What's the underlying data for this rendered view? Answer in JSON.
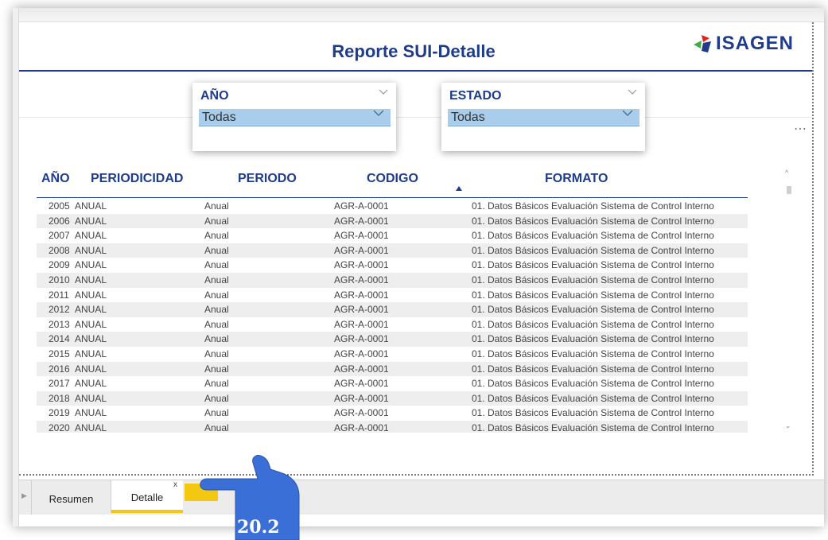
{
  "header": {
    "title": "Reporte SUI-Detalle",
    "logo_text": "ISAGEN"
  },
  "slicers": [
    {
      "label": "AÑO",
      "value": "Todas"
    },
    {
      "label": "ESTADO",
      "value": "Todas"
    }
  ],
  "table": {
    "columns": [
      "AÑO",
      "PERIODICIDAD",
      "PERIODO",
      "CODIGO",
      "FORMATO"
    ],
    "sorted_column": "FORMATO",
    "rows": [
      [
        "2005",
        "ANUAL",
        "Anual",
        "AGR-A-0001",
        "01. Datos Básicos Evaluación Sistema de Control Interno"
      ],
      [
        "2006",
        "ANUAL",
        "Anual",
        "AGR-A-0001",
        "01. Datos Básicos Evaluación Sistema de Control Interno"
      ],
      [
        "2007",
        "ANUAL",
        "Anual",
        "AGR-A-0001",
        "01. Datos Básicos Evaluación Sistema de Control Interno"
      ],
      [
        "2008",
        "ANUAL",
        "Anual",
        "AGR-A-0001",
        "01. Datos Básicos Evaluación Sistema de Control Interno"
      ],
      [
        "2009",
        "ANUAL",
        "Anual",
        "AGR-A-0001",
        "01. Datos Básicos Evaluación Sistema de Control Interno"
      ],
      [
        "2010",
        "ANUAL",
        "Anual",
        "AGR-A-0001",
        "01. Datos Básicos Evaluación Sistema de Control Interno"
      ],
      [
        "2011",
        "ANUAL",
        "Anual",
        "AGR-A-0001",
        "01. Datos Básicos Evaluación Sistema de Control Interno"
      ],
      [
        "2012",
        "ANUAL",
        "Anual",
        "AGR-A-0001",
        "01. Datos Básicos Evaluación Sistema de Control Interno"
      ],
      [
        "2013",
        "ANUAL",
        "Anual",
        "AGR-A-0001",
        "01. Datos Básicos Evaluación Sistema de Control Interno"
      ],
      [
        "2014",
        "ANUAL",
        "Anual",
        "AGR-A-0001",
        "01. Datos Básicos Evaluación Sistema de Control Interno"
      ],
      [
        "2015",
        "ANUAL",
        "Anual",
        "AGR-A-0001",
        "01. Datos Básicos Evaluación Sistema de Control Interno"
      ],
      [
        "2016",
        "ANUAL",
        "Anual",
        "AGR-A-0001",
        "01. Datos Básicos Evaluación Sistema de Control Interno"
      ],
      [
        "2017",
        "ANUAL",
        "Anual",
        "AGR-A-0001",
        "01. Datos Básicos Evaluación Sistema de Control Interno"
      ],
      [
        "2018",
        "ANUAL",
        "Anual",
        "AGR-A-0001",
        "01. Datos Básicos Evaluación Sistema de Control Interno"
      ],
      [
        "2019",
        "ANUAL",
        "Anual",
        "AGR-A-0001",
        "01. Datos Básicos Evaluación Sistema de Control Interno"
      ],
      [
        "2020",
        "ANUAL",
        "Anual",
        "AGR-A-0001",
        "01. Datos Básicos Evaluación Sistema de Control Interno"
      ]
    ]
  },
  "tabs": [
    {
      "label": "Resumen",
      "active": false
    },
    {
      "label": "Detalle",
      "active": true
    }
  ],
  "tab_close_label": "x",
  "callout": {
    "label": "20.2",
    "color": "#3b6fd8"
  },
  "colors": {
    "brand": "#1f3c8c",
    "slicer_fill": "#a9cdea",
    "active_tab": "#f2c811",
    "logo_green": "#3fae49",
    "logo_red": "#e2231a",
    "logo_blue": "#1f3c8c"
  },
  "icons": {
    "more": "more-options-icon",
    "sort": "sort-ascending-icon",
    "dropdown": "chevron-down-icon"
  }
}
